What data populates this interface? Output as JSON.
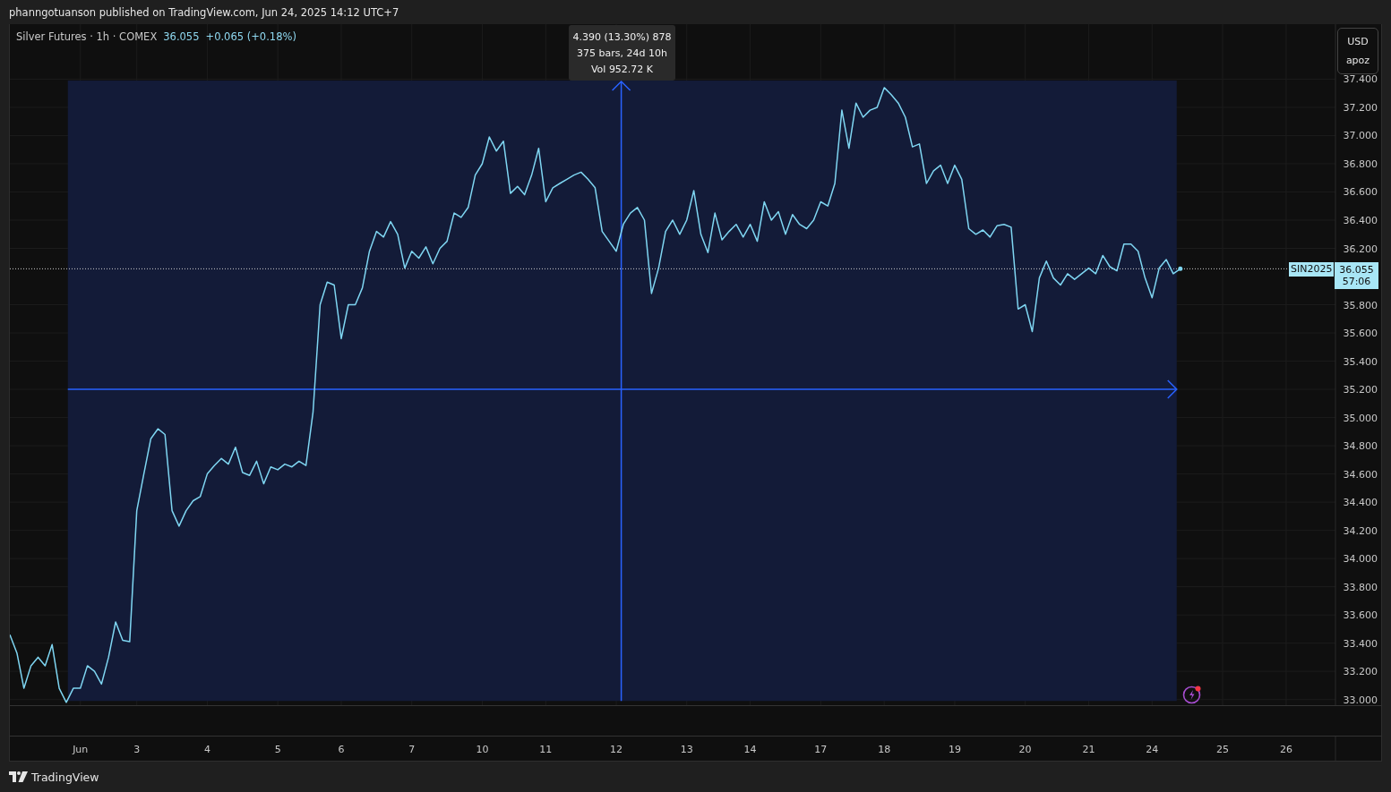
{
  "attribution": "phanngotuanson published on TradingView.com, Jun 24, 2025 14:12 UTC+7",
  "legend": {
    "symbol": "Silver Futures · 1h · COMEX",
    "price": "36.055",
    "change": "+0.065 (+0.18%)"
  },
  "currency_button": {
    "currency": "USD",
    "unit": "apoz"
  },
  "measure_tool": {
    "lines": [
      "4.390 (13.30%) 878",
      "375 bars, 24d 10h",
      "Vol 952.72 K"
    ]
  },
  "price_label": {
    "symbol": "SIN2025",
    "price": "36.055",
    "countdown": "57:06"
  },
  "chart_data": {
    "type": "line",
    "grid": true,
    "ref_lines": [
      {
        "axis": "y",
        "value": 36.055
      }
    ],
    "ylim": [
      32.96,
      37.79
    ],
    "yticks": [
      {
        "value": 33.0,
        "label": "33.000"
      },
      {
        "value": 33.2,
        "label": "33.200"
      },
      {
        "value": 33.4,
        "label": "33.400"
      },
      {
        "value": 33.6,
        "label": "33.600"
      },
      {
        "value": 33.8,
        "label": "33.800"
      },
      {
        "value": 34.0,
        "label": "34.000"
      },
      {
        "value": 34.2,
        "label": "34.200"
      },
      {
        "value": 34.4,
        "label": "34.400"
      },
      {
        "value": 34.6,
        "label": "34.600"
      },
      {
        "value": 34.8,
        "label": "34.800"
      },
      {
        "value": 35.0,
        "label": "35.000"
      },
      {
        "value": 35.2,
        "label": "35.200"
      },
      {
        "value": 35.4,
        "label": "35.400"
      },
      {
        "value": 35.6,
        "label": "35.600"
      },
      {
        "value": 35.8,
        "label": "35.800"
      },
      {
        "value": 36.2,
        "label": "36.200"
      },
      {
        "value": 36.4,
        "label": "36.400"
      },
      {
        "value": 36.6,
        "label": "36.600"
      },
      {
        "value": 36.8,
        "label": "36.800"
      },
      {
        "value": 37.0,
        "label": "37.000"
      },
      {
        "value": 37.2,
        "label": "37.200"
      },
      {
        "value": 37.4,
        "label": "37.400"
      }
    ],
    "categories": [
      null,
      null,
      null,
      null,
      null,
      null,
      null,
      null,
      null,
      null,
      "Jun",
      null,
      null,
      null,
      null,
      null,
      null,
      null,
      "3",
      null,
      null,
      null,
      null,
      null,
      null,
      null,
      null,
      null,
      "4",
      null,
      null,
      null,
      null,
      null,
      null,
      null,
      null,
      null,
      "5",
      null,
      null,
      null,
      null,
      null,
      null,
      null,
      null,
      "6",
      null,
      null,
      null,
      null,
      null,
      null,
      null,
      null,
      null,
      "7",
      null,
      null,
      null,
      null,
      null,
      null,
      null,
      null,
      null,
      "10",
      null,
      null,
      null,
      null,
      null,
      null,
      null,
      null,
      "11",
      null,
      null,
      null,
      null,
      null,
      null,
      null,
      null,
      null,
      "12",
      null,
      null,
      null,
      null,
      null,
      null,
      null,
      null,
      null,
      "13",
      null,
      null,
      null,
      null,
      null,
      null,
      null,
      null,
      "14",
      null,
      null,
      null,
      null,
      null,
      null,
      null,
      null,
      null,
      "17",
      null,
      null,
      null,
      null,
      null,
      null,
      null,
      null,
      "18",
      null,
      null,
      null,
      null,
      null,
      null,
      null,
      null,
      null,
      "19",
      null,
      null,
      null,
      null,
      null,
      null,
      null,
      null,
      null,
      "20",
      null,
      null,
      null,
      null,
      null,
      null,
      null,
      null,
      "21",
      null,
      null,
      null,
      null,
      null,
      null,
      null,
      null,
      "24",
      null,
      null,
      null,
      null,
      null,
      null,
      null,
      null,
      null,
      "25",
      null,
      null,
      null,
      null,
      null,
      null,
      null,
      null,
      "26",
      null,
      null,
      null,
      null,
      null,
      null,
      null
    ],
    "series": [
      {
        "color": "#7fd6f2",
        "values": [
          33.46,
          33.33,
          33.08,
          33.24,
          33.3,
          33.24,
          33.39,
          33.08,
          32.98,
          33.08,
          33.08,
          33.24,
          33.2,
          33.11,
          33.3,
          33.55,
          33.42,
          33.41,
          34.34,
          34.6,
          34.85,
          34.92,
          34.88,
          34.34,
          34.23,
          34.34,
          34.41,
          34.44,
          34.6,
          34.66,
          34.71,
          34.67,
          34.79,
          34.61,
          34.59,
          34.69,
          34.53,
          34.65,
          34.63,
          34.67,
          34.65,
          34.69,
          34.66,
          35.04,
          35.8,
          35.96,
          35.94,
          35.56,
          35.8,
          35.8,
          35.92,
          36.18,
          36.32,
          36.28,
          36.39,
          36.3,
          36.06,
          36.18,
          36.13,
          36.21,
          36.09,
          36.2,
          36.25,
          36.45,
          36.42,
          36.49,
          36.72,
          36.8,
          36.99,
          36.89,
          36.96,
          36.59,
          36.64,
          36.58,
          36.72,
          36.91,
          36.53,
          36.63,
          36.66,
          36.69,
          36.72,
          36.74,
          36.69,
          36.63,
          36.32,
          36.25,
          36.18,
          36.37,
          36.45,
          36.49,
          36.4,
          35.88,
          36.06,
          36.32,
          36.4,
          36.3,
          36.4,
          36.61,
          36.3,
          36.17,
          36.45,
          36.26,
          36.32,
          36.37,
          36.28,
          36.37,
          36.25,
          36.53,
          36.4,
          36.46,
          36.3,
          36.44,
          36.37,
          36.34,
          36.4,
          36.53,
          36.5,
          36.66,
          37.18,
          36.91,
          37.23,
          37.13,
          37.18,
          37.2,
          37.34,
          37.29,
          37.23,
          37.13,
          36.92,
          36.94,
          36.66,
          36.75,
          36.79,
          36.66,
          36.79,
          36.69,
          36.34,
          36.3,
          36.33,
          36.28,
          36.36,
          36.37,
          36.35,
          35.77,
          35.8,
          35.61,
          35.99,
          36.11,
          35.99,
          35.94,
          36.02,
          35.98,
          36.02,
          36.06,
          36.02,
          36.15,
          36.07,
          36.04,
          36.23,
          36.23,
          36.18,
          35.99,
          35.85,
          36.06,
          36.12,
          36.02,
          36.055,
          null,
          null,
          null,
          null,
          null,
          null,
          null,
          null,
          null,
          null,
          null,
          null,
          null,
          null,
          null,
          null,
          null,
          null,
          null,
          null,
          null,
          null
        ]
      }
    ]
  },
  "footer": {
    "brand": "TradingView"
  }
}
